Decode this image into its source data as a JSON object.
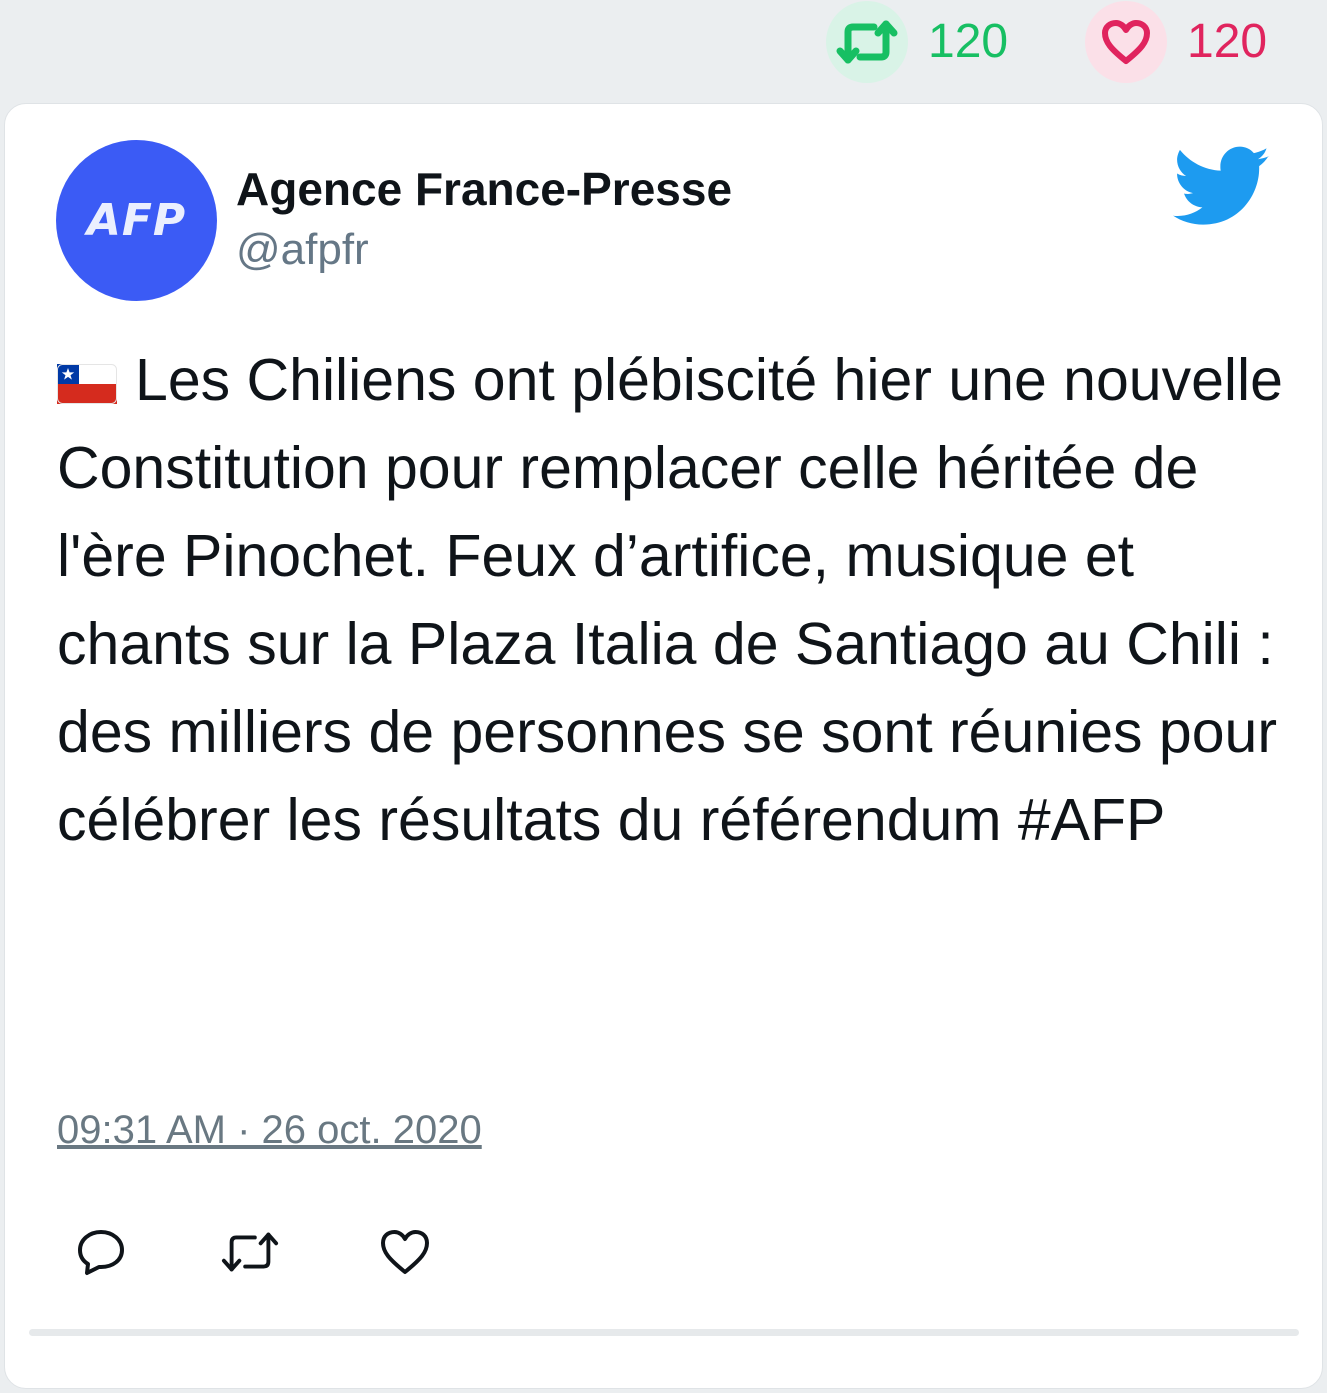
{
  "stats": {
    "retweet_count": "120",
    "like_count": "120"
  },
  "author": {
    "avatar_text": "AFP",
    "name": "Agence France-Presse",
    "handle": "@afpfr"
  },
  "tweet": {
    "flag_icon": "chile-flag-icon",
    "text": "Les Chiliens ont plébiscité hier une nouvelle Constitution pour remplacer celle héritée de l'ère Pinochet. Feux d’artifice, musique et chants sur la Plaza Italia de Santiago au Chili : des milliers de personnes se sont réunies pour célébrer les résultats du référendum #AFP",
    "timestamp": "09:31 AM · 26 oct. 2020"
  },
  "icons": {
    "retweet": "retweet-icon",
    "like": "heart-icon",
    "reply": "reply-icon",
    "brand": "twitter-bird-icon"
  },
  "colors": {
    "retweet": "#17bf63",
    "like": "#e0245e",
    "avatar": "#3b5bf5",
    "twitter_blue": "#1d9bf0",
    "muted": "#657786"
  }
}
